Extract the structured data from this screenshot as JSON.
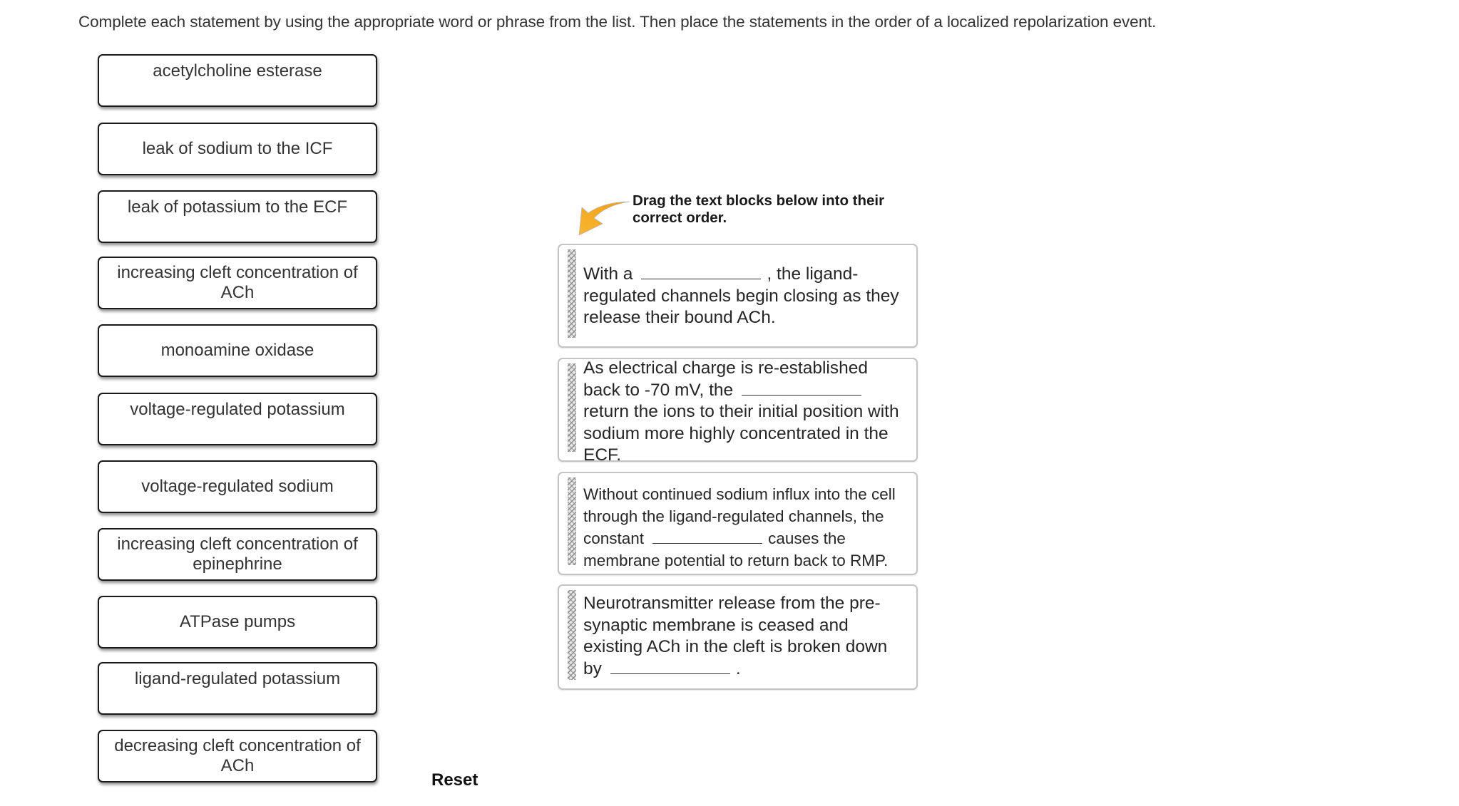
{
  "instructions": "Complete each statement by using the appropriate word or phrase from the list. Then place the statements in the order of a localized repolarization event.",
  "label_bank": [
    {
      "lines": [
        "acetylcholine esterase"
      ]
    },
    {
      "lines": [
        "leak of sodium to the ICF"
      ]
    },
    {
      "lines": [
        "leak of potassium to the ECF"
      ]
    },
    {
      "lines": [
        "increasing cleft concentration of",
        "ACh"
      ]
    },
    {
      "lines": [
        "monoamine oxidase"
      ]
    },
    {
      "lines": [
        "voltage-regulated potassium"
      ]
    },
    {
      "lines": [
        "voltage-regulated sodium"
      ]
    },
    {
      "lines": [
        "increasing cleft concentration of",
        "epinephrine"
      ]
    },
    {
      "lines": [
        "ATPase pumps"
      ]
    },
    {
      "lines": [
        "ligand-regulated potassium"
      ]
    },
    {
      "lines": [
        "decreasing cleft concentration of",
        "ACh"
      ]
    }
  ],
  "hint": {
    "line1": "Drag the text blocks below into their",
    "line2": "correct order.",
    "arrow_color": "#F5A623"
  },
  "statements": [
    {
      "before": "With a",
      "after": ", the ligand-regulated channels begin closing as they release their bound ACh."
    },
    {
      "before": "As electrical charge is re-established back to -70 mV, the",
      "after": "return the ions to their initial position with sodium more highly concentrated in the ECF."
    },
    {
      "before": "Without continued sodium influx into the cell through the ligand-regulated channels, the constant",
      "after": "causes the membrane potential to return back to RMP."
    },
    {
      "before": "Neurotransmitter release from the pre-synaptic membrane is ceased and existing ACh in the cleft is broken down by",
      "after": "."
    }
  ],
  "reset_label": "Reset"
}
